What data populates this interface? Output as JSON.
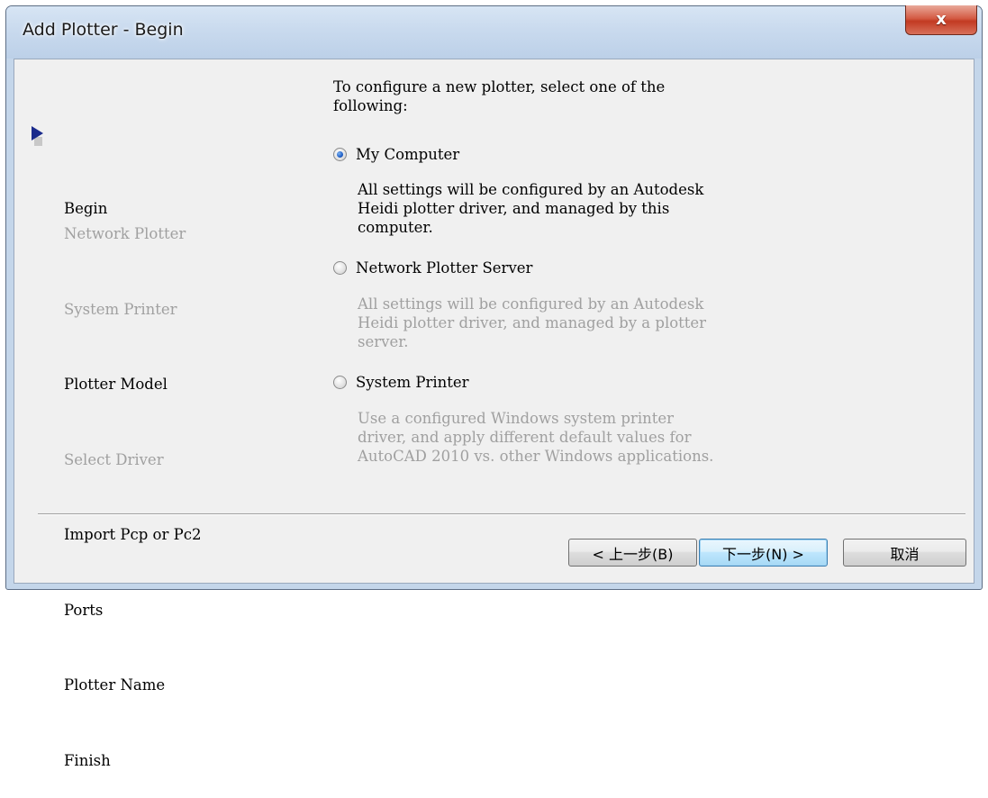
{
  "window": {
    "title": "Add Plotter - Begin",
    "close_label": "x"
  },
  "steps": [
    {
      "label": "Begin",
      "state": "current"
    },
    {
      "label": "Network Plotter",
      "state": "disabled"
    },
    {
      "label": "System Printer",
      "state": "disabled"
    },
    {
      "label": "Plotter Model",
      "state": "enabled"
    },
    {
      "label": "Select Driver",
      "state": "disabled"
    },
    {
      "label": "Import Pcp or Pc2",
      "state": "enabled"
    },
    {
      "label": "Ports",
      "state": "enabled"
    },
    {
      "label": "Plotter Name",
      "state": "enabled"
    },
    {
      "label": "Finish",
      "state": "enabled"
    }
  ],
  "main": {
    "intro_line1": "To configure a new plotter, select one of the",
    "intro_line2": "following:",
    "options": [
      {
        "label": "My Computer",
        "checked": true,
        "desc_line1": "All settings will be configured by an Autodesk",
        "desc_line2": "Heidi plotter driver, and managed by this",
        "desc_line3": "computer."
      },
      {
        "label": "Network Plotter Server",
        "checked": false,
        "desc_line1": "All settings will be configured by an Autodesk",
        "desc_line2": "Heidi plotter driver, and managed by a plotter",
        "desc_line3": "server."
      },
      {
        "label": "System Printer",
        "checked": false,
        "desc_line1": "Use a configured Windows system printer",
        "desc_line2": "driver, and apply different default values for",
        "desc_line3": "AutoCAD 2010 vs. other Windows applications."
      }
    ]
  },
  "buttons": {
    "back": "< 上一步(B)",
    "next": "下一步(N) >",
    "cancel": "取消"
  },
  "colors": {
    "disabled_text": "#a0a0a0",
    "radio_selected": "#1f5fc8",
    "step_arrow": "#1a2a8c",
    "close_button": "#c23a22"
  }
}
